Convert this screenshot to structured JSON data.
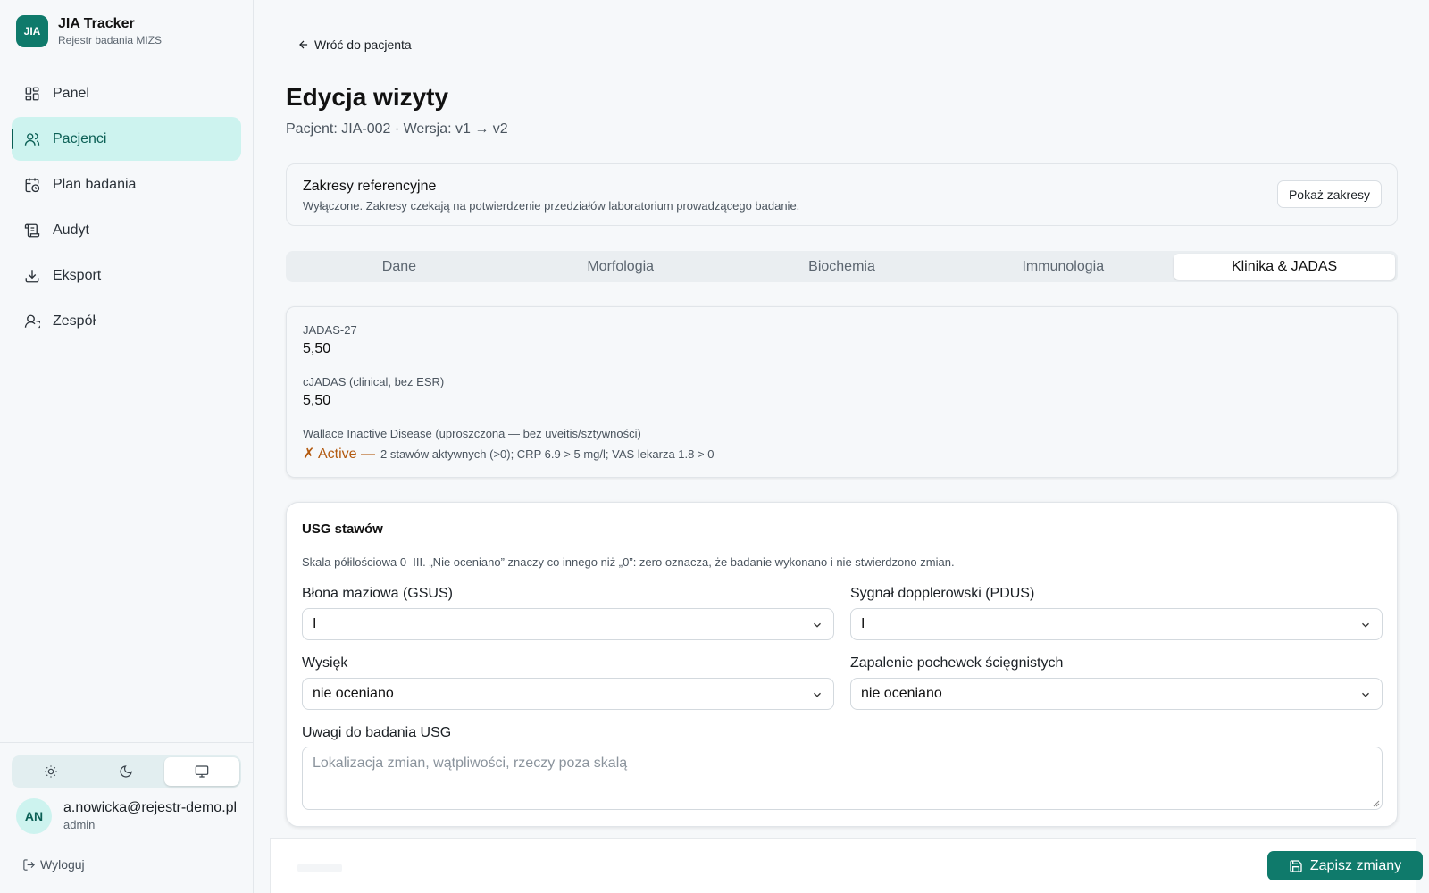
{
  "brand": {
    "logo": "JIA",
    "name": "JIA Tracker",
    "subtitle": "Rejestr badania MIZS"
  },
  "nav": [
    {
      "label": "Panel",
      "icon": "dashboard-icon",
      "active": false
    },
    {
      "label": "Pacjenci",
      "icon": "users-icon",
      "active": true
    },
    {
      "label": "Plan badania",
      "icon": "calendar-clock-icon",
      "active": false
    },
    {
      "label": "Audyt",
      "icon": "scroll-icon",
      "active": false
    },
    {
      "label": "Eksport",
      "icon": "download-icon",
      "active": false
    },
    {
      "label": "Zespół",
      "icon": "user-icon",
      "active": false
    }
  ],
  "theme": {
    "options": [
      "sun-icon",
      "moon-icon",
      "monitor-icon"
    ],
    "selected": "monitor-icon"
  },
  "user": {
    "initials": "AN",
    "email": "a.nowicka@rejestr-demo.pl",
    "role": "admin"
  },
  "logout_label": "Wyloguj",
  "back_label": "Wróć do pacjenta",
  "page": {
    "title": "Edycja wizyty",
    "subtitle": "Pacjent: JIA-002 · Wersja: v1 → v2"
  },
  "ref": {
    "title": "Zakresy referencyjne",
    "desc": "Wyłączone. Zakresy czekają na potwierdzenie przedziałów laboratorium prowadzącego badanie.",
    "button": "Pokaż zakresy"
  },
  "tabs": [
    {
      "label": "Dane",
      "active": false
    },
    {
      "label": "Morfologia",
      "active": false
    },
    {
      "label": "Biochemia",
      "active": false
    },
    {
      "label": "Immunologia",
      "active": false
    },
    {
      "label": "Klinika & JADAS",
      "active": true
    }
  ],
  "scores": {
    "jadas27_label": "JADAS-27",
    "jadas27_value": "5,50",
    "cjadas_label": "cJADAS (clinical, bez ESR)",
    "cjadas_value": "5,50",
    "wallace_label": "Wallace Inactive Disease (uproszczona — bez uveitis/sztywności)",
    "wallace_status": "✗ Active —",
    "wallace_detail": "2 stawów aktywnych (>0); CRP 6.9 > 5 mg/l; VAS lekarza 1.8 > 0"
  },
  "usg": {
    "title": "USG stawów",
    "desc": "Skala półilościowa 0–III. „Nie oceniano” znaczy co innego niż „0”: zero oznacza, że badanie wykonano i nie stwierdzono zmian.",
    "gsus_label": "Błona maziowa (GSUS)",
    "gsus_value": "I",
    "pdus_label": "Sygnał dopplerowski (PDUS)",
    "pdus_value": "I",
    "effusion_label": "Wysięk",
    "effusion_value": "nie oceniano",
    "tenosynovitis_label": "Zapalenie pochewek ścięgnistych",
    "tenosynovitis_value": "nie oceniano",
    "notes_label": "Uwagi do badania USG",
    "notes_placeholder": "Lokalizacja zmian, wątpliwości, rzeczy poza skalą"
  },
  "save_label": "Zapisz zmiany",
  "colors": {
    "accent": "#0f7a6b",
    "active_nav_bg": "#cdf3ef",
    "status_active": "#b35a10"
  }
}
